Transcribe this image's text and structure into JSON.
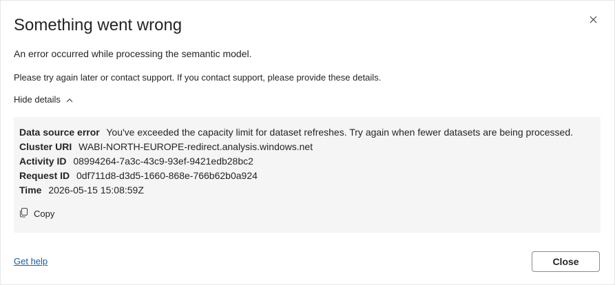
{
  "dialog": {
    "title": "Something went wrong",
    "message": "An error occurred while processing the semantic model.",
    "support_message": "Please try again later or contact support. If you contact support, please provide these details.",
    "toggle_label": "Hide details",
    "details": [
      {
        "label": "Data source error",
        "value": "You've exceeded the capacity limit for dataset refreshes. Try again when fewer datasets are being processed."
      },
      {
        "label": "Cluster URI",
        "value": "WABI-NORTH-EUROPE-redirect.analysis.windows.net"
      },
      {
        "label": "Activity ID",
        "value": "08994264-7a3c-43c9-93ef-9421edb28bc2"
      },
      {
        "label": "Request ID",
        "value": "0df711d8-d3d5-1660-868e-766b62b0a924"
      },
      {
        "label": "Time",
        "value": "2026-05-15 15:08:59Z"
      }
    ],
    "copy_label": "Copy",
    "get_help_label": "Get help",
    "close_label": "Close"
  },
  "icons": {
    "close": "close-icon",
    "chevron": "chevron-up-icon",
    "copy": "copy-icon"
  },
  "colors": {
    "link": "#115ea3",
    "details_bg": "#f5f5f5",
    "text": "#242424"
  }
}
